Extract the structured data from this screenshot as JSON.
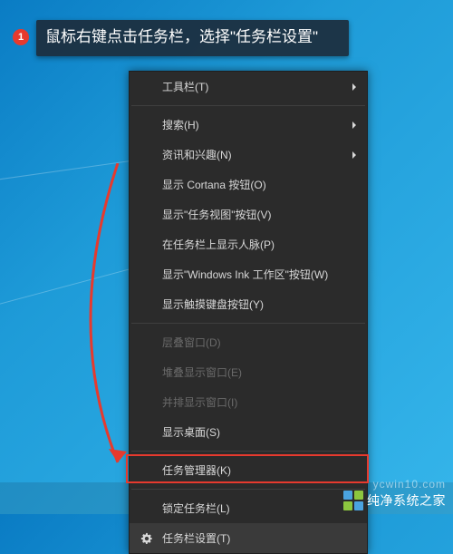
{
  "step": {
    "number": "1",
    "tooltip": "鼠标右键点击任务栏，选择\"任务栏设置\""
  },
  "menu": {
    "items": [
      {
        "label": "工具栏(T)",
        "arrow": true,
        "disabled": false
      },
      {
        "sep": true
      },
      {
        "label": "搜索(H)",
        "arrow": true,
        "disabled": false
      },
      {
        "label": "资讯和兴趣(N)",
        "arrow": true,
        "disabled": false
      },
      {
        "label": "显示 Cortana 按钮(O)",
        "arrow": false,
        "disabled": false
      },
      {
        "label": "显示\"任务视图\"按钮(V)",
        "arrow": false,
        "disabled": false
      },
      {
        "label": "在任务栏上显示人脉(P)",
        "arrow": false,
        "disabled": false
      },
      {
        "label": "显示\"Windows Ink 工作区\"按钮(W)",
        "arrow": false,
        "disabled": false
      },
      {
        "label": "显示触摸键盘按钮(Y)",
        "arrow": false,
        "disabled": false
      },
      {
        "sep": true
      },
      {
        "label": "层叠窗口(D)",
        "arrow": false,
        "disabled": true
      },
      {
        "label": "堆叠显示窗口(E)",
        "arrow": false,
        "disabled": true
      },
      {
        "label": "并排显示窗口(I)",
        "arrow": false,
        "disabled": true
      },
      {
        "label": "显示桌面(S)",
        "arrow": false,
        "disabled": false
      },
      {
        "sep": true
      },
      {
        "label": "任务管理器(K)",
        "arrow": false,
        "disabled": false
      },
      {
        "sep": true
      },
      {
        "label": "锁定任务栏(L)",
        "arrow": false,
        "disabled": false
      },
      {
        "label": "任务栏设置(T)",
        "arrow": false,
        "disabled": false,
        "icon": "gear",
        "highlighted": true
      }
    ]
  },
  "watermark": {
    "text": "纯净系统之家",
    "url": "ycwin10.com"
  }
}
